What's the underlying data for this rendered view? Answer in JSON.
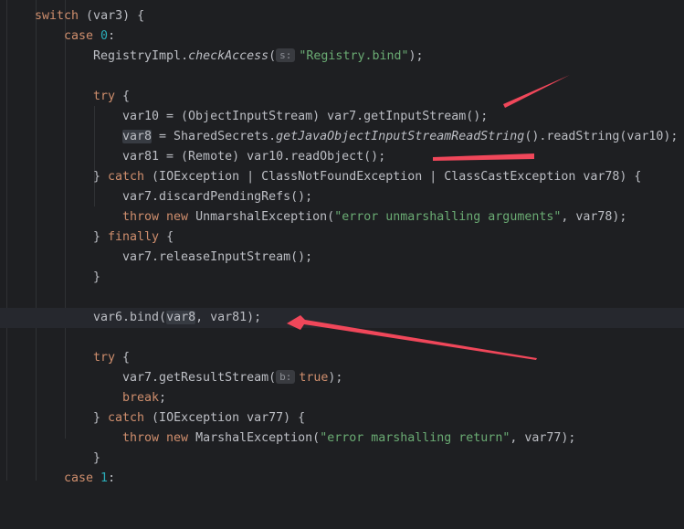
{
  "code": {
    "switch_kw": "switch",
    "switch_cond": " (var3) {",
    "case_kw": "case",
    "case0_num": "0",
    "colon": ":",
    "check_pre": "RegistryImpl.",
    "check_method": "checkAccess",
    "paren_open": "(",
    "check_hint": "s:",
    "check_arg": "\"Registry.bind\"",
    "check_post": ");",
    "try_kw": "try",
    "brace_open": " {",
    "var10_line": "var10 = (ObjectInputStream) var7.getInputStream();",
    "var8_name": "var8",
    "var8_mid": " = SharedSecrets.",
    "var8_method": "getJavaObjectInputStreamReadString",
    "var8_post": "().readString(var10);",
    "var81_line": "var81 = (Remote) var10.readObject();",
    "close_brace": "}",
    "close_brace_sp": "} ",
    "catch_kw": "catch",
    "catch1_rest": " (IOException | ClassNotFoundException | ClassCastException var78) {",
    "discard_line": "var7.discardPendingRefs();",
    "throw_kw": "throw",
    "new_kw": "new",
    "unmarshal_pre": " UnmarshalException(",
    "unmarshal_msg": "\"error unmarshalling arguments\"",
    "unmarshal_post": ", var78);",
    "finally_kw": "finally",
    "release_line": "var7.releaseInputStream();",
    "bind_pre": "var6.bind(",
    "bind_arg": "var8",
    "bind_post": ", var81);",
    "result_pre": "var7.getResultStream(",
    "result_hint": "b:",
    "true_kw": "true",
    "break_kw": "break",
    "semicolon": ";",
    "catch2_rest": " (IOException var77) {",
    "marshal_pre": " MarshalException(",
    "marshal_msg": "\"error marshalling return\"",
    "marshal_post": ", var77);",
    "case1_num": "1",
    "space": " "
  },
  "colors": {
    "background": "#1e1f22",
    "keyword": "#cf8e6d",
    "string": "#6aab73",
    "number": "#2aacb8",
    "annotation_arrow": "#f0475a"
  }
}
